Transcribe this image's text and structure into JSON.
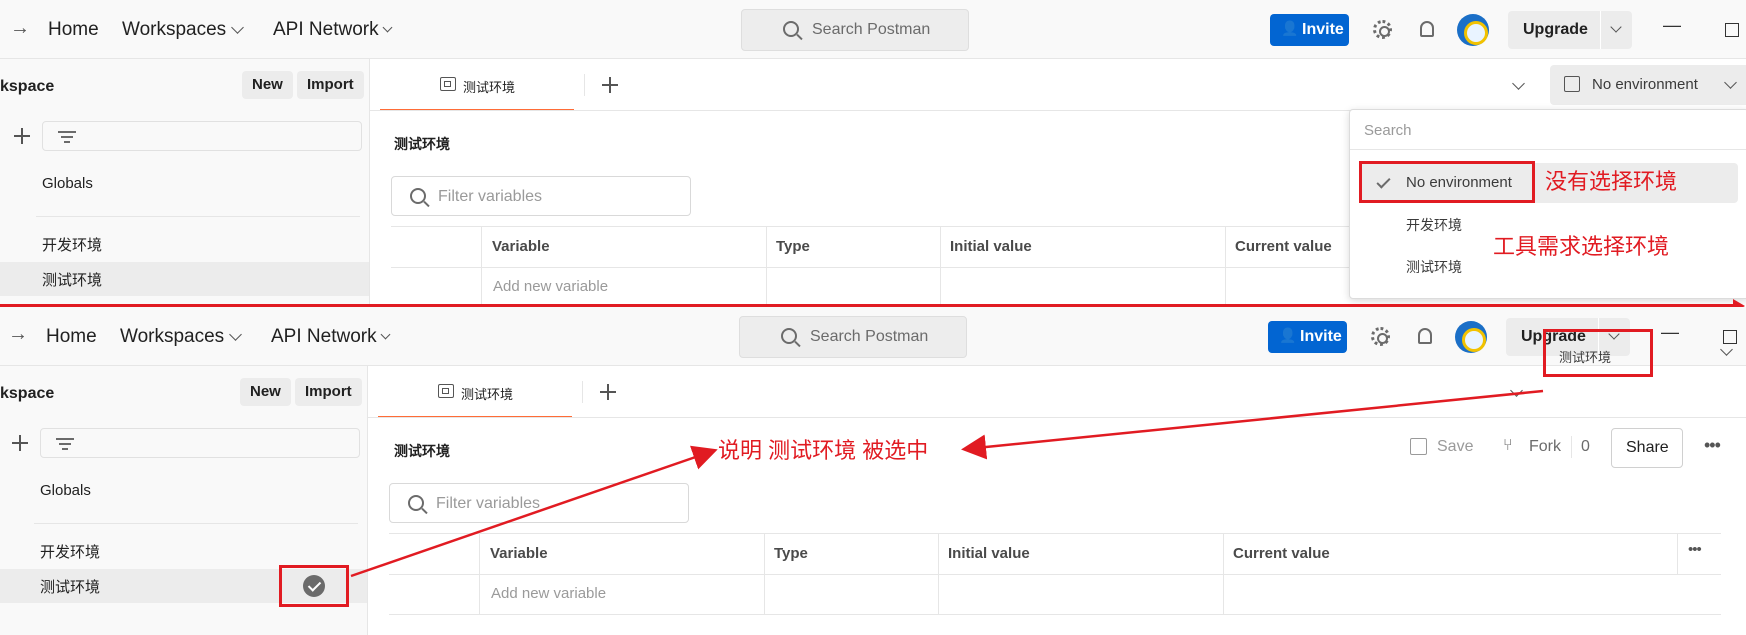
{
  "colors": {
    "accent": "#ff6c37",
    "invite": "#0265d2",
    "annotation": "#e11b22"
  },
  "top_panel": {
    "nav": {
      "home": "Home",
      "workspaces": "Workspaces",
      "api_network": "API Network"
    },
    "search_placeholder": "Search Postman",
    "invite": "Invite",
    "upgrade": "Upgrade",
    "sidebar": {
      "title": "kspace",
      "new": "New",
      "import": "Import",
      "items": [
        "Globals",
        "开发环境",
        "测试环境"
      ]
    },
    "tab": "测试环境",
    "env_selector": "No environment",
    "heading": "测试环境",
    "filter_placeholder": "Filter variables",
    "columns": [
      "Variable",
      "Type",
      "Initial value",
      "Current value"
    ],
    "add_row_placeholder": "Add new variable",
    "dropdown": {
      "search_placeholder": "Search",
      "options": [
        "No environment",
        "开发环境",
        "测试环境"
      ],
      "selected": "No environment"
    },
    "annotations": {
      "no_env": "没有选择环境",
      "tool_need": "工具需求选择环境"
    }
  },
  "bottom_panel": {
    "nav": {
      "home": "Home",
      "workspaces": "Workspaces",
      "api_network": "API Network"
    },
    "search_placeholder": "Search Postman",
    "invite": "Invite",
    "upgrade": "Upgrade",
    "sidebar": {
      "title": "kspace",
      "new": "New",
      "import": "Import",
      "items": [
        "Globals",
        "开发环境",
        "测试环境"
      ]
    },
    "tab": "测试环境",
    "env_selector": "测试环境",
    "heading": "测试环境",
    "save": "Save",
    "fork": "Fork",
    "fork_count": "0",
    "share": "Share",
    "filter_placeholder": "Filter variables",
    "columns": [
      "Variable",
      "Type",
      "Initial value",
      "Current value"
    ],
    "add_row_placeholder": "Add new variable",
    "annotation": "说明  测试环境  被选中"
  }
}
